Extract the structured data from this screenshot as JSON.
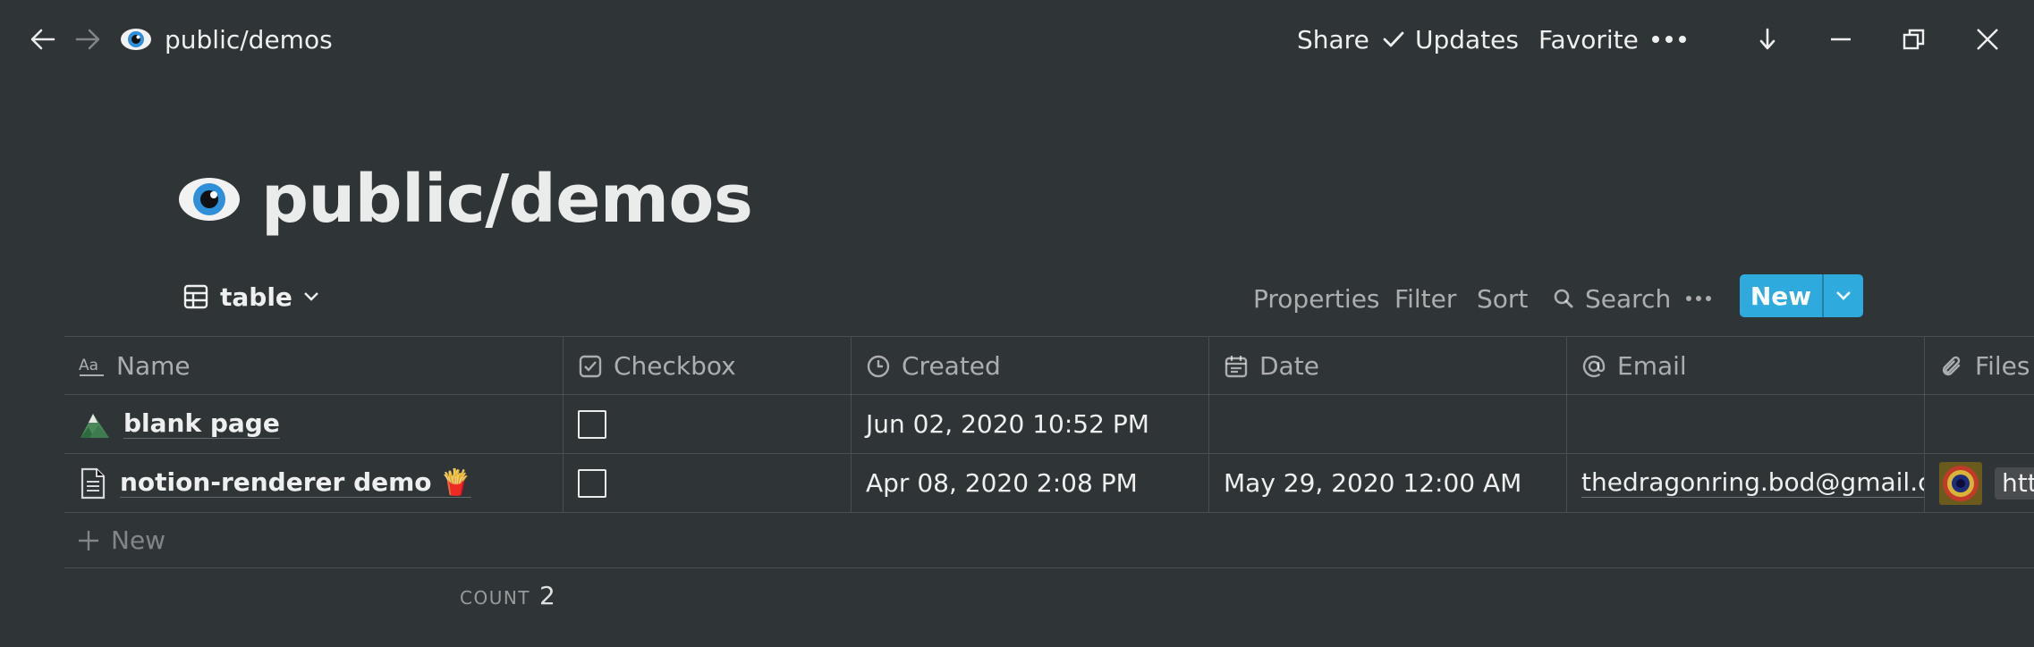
{
  "topbar": {
    "breadcrumb": "public/demos",
    "share": "Share",
    "updates": "Updates",
    "favorite": "Favorite"
  },
  "page": {
    "title": "public/demos",
    "icon": "eye-icon"
  },
  "view": {
    "label": "table",
    "properties": "Properties",
    "filter": "Filter",
    "sort": "Sort",
    "search": "Search",
    "new": "New"
  },
  "table": {
    "columns": {
      "name": "Name",
      "checkbox": "Checkbox",
      "created": "Created",
      "date": "Date",
      "email": "Email",
      "files": "Files"
    },
    "rows": [
      {
        "name": "blank page",
        "icon": "mountain-icon",
        "checked": false,
        "created": "Jun 02, 2020 10:52 PM",
        "date": "",
        "email": "",
        "file": ""
      },
      {
        "name": "notion-renderer demo 🍟",
        "icon": "document-icon",
        "checked": false,
        "created": "Apr 08, 2020 2:08 PM",
        "date": "May 29, 2020 12:00 AM",
        "email": "thedragonring.bod@gmail.com",
        "file": "htt"
      }
    ],
    "new_row": "New",
    "count_label": "COUNT",
    "count_value": "2"
  },
  "colors": {
    "background": "#2f3437",
    "accent": "#2eaadc"
  }
}
